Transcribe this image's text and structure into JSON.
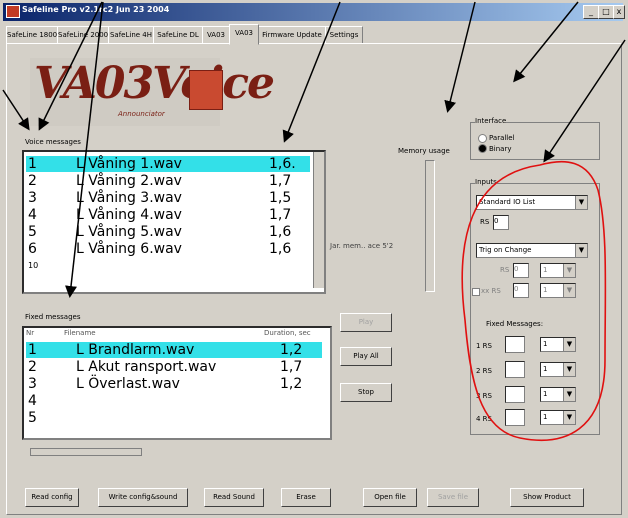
{
  "window": {
    "title": "Safeline Pro v2.1rc2  Jun 23 2004"
  },
  "tabs": [
    "SafeLine 1800",
    "SafeLine 2000",
    "SafeLine 4H",
    "SafeLine DL",
    "VA03",
    "VA03",
    "Firmware Update",
    "Settings"
  ],
  "logo": {
    "text": "VA03Voice",
    "sub": "Announciator"
  },
  "voice": {
    "label": "Voice messages",
    "rows": [
      {
        "num": "1",
        "name": "L Våning 1.wav",
        "dur": "1,6."
      },
      {
        "num": "2",
        "name": "L Våning 2.wav",
        "dur": "1,7"
      },
      {
        "num": "3",
        "name": "L Våning 3.wav",
        "dur": "1,5"
      },
      {
        "num": "4",
        "name": "L Våning 4.wav",
        "dur": "1,7"
      },
      {
        "num": "5",
        "name": "L Våning 5.wav",
        "dur": "1,6"
      },
      {
        "num": "6",
        "name": "L Våning 6.wav",
        "dur": "1,6"
      },
      {
        "num": "10",
        "name": "",
        "dur": ""
      }
    ]
  },
  "fixed": {
    "label": "Fixed messages",
    "col_nr": "Nr",
    "col_name": "Filename",
    "col_dur": "Duration, sec",
    "rows": [
      {
        "num": "1",
        "name": "L Brandlarm.wav",
        "dur": "1,2"
      },
      {
        "num": "2",
        "name": "L Akut ransport.wav",
        "dur": "1,7"
      },
      {
        "num": "3",
        "name": "L Överlast.wav",
        "dur": "1,2"
      },
      {
        "num": "4",
        "name": "",
        "dur": ""
      },
      {
        "num": "5",
        "name": "",
        "dur": ""
      }
    ]
  },
  "memory": {
    "usage_label": "Memory usage",
    "max_label": "Jar. mem.. ace 5'2"
  },
  "interface": {
    "label": "Interface",
    "opt1": "Parallel",
    "opt2": "Binary"
  },
  "inputs": {
    "label": "Inputs",
    "list_value": "Standard IO List",
    "rs_label": "RS",
    "rs_value": "0",
    "trigger_value": "Trig on Change",
    "rs2_label": "RS",
    "rs2_value": "0",
    "rs2_sel": "1",
    "rs3_label": "xx RS",
    "rs3_value": "0",
    "rs3_sel": "1",
    "fixed_label": "Fixed Messages:",
    "fixed_rows": [
      {
        "label": "1 RS",
        "value": "1"
      },
      {
        "label": "2 RS",
        "value": "1"
      },
      {
        "label": "3 RS",
        "value": "1"
      },
      {
        "label": "4 RS",
        "value": "1"
      }
    ]
  },
  "buttons": {
    "play": "Play",
    "play_all": "Play All",
    "stop": "Stop",
    "read_config": "Read config",
    "write_config": "Write config&sound",
    "read_sound": "Read Sound",
    "erase": "Erase",
    "open_file": "Open file",
    "save_file": "Save file",
    "show_product": "Show Product"
  }
}
